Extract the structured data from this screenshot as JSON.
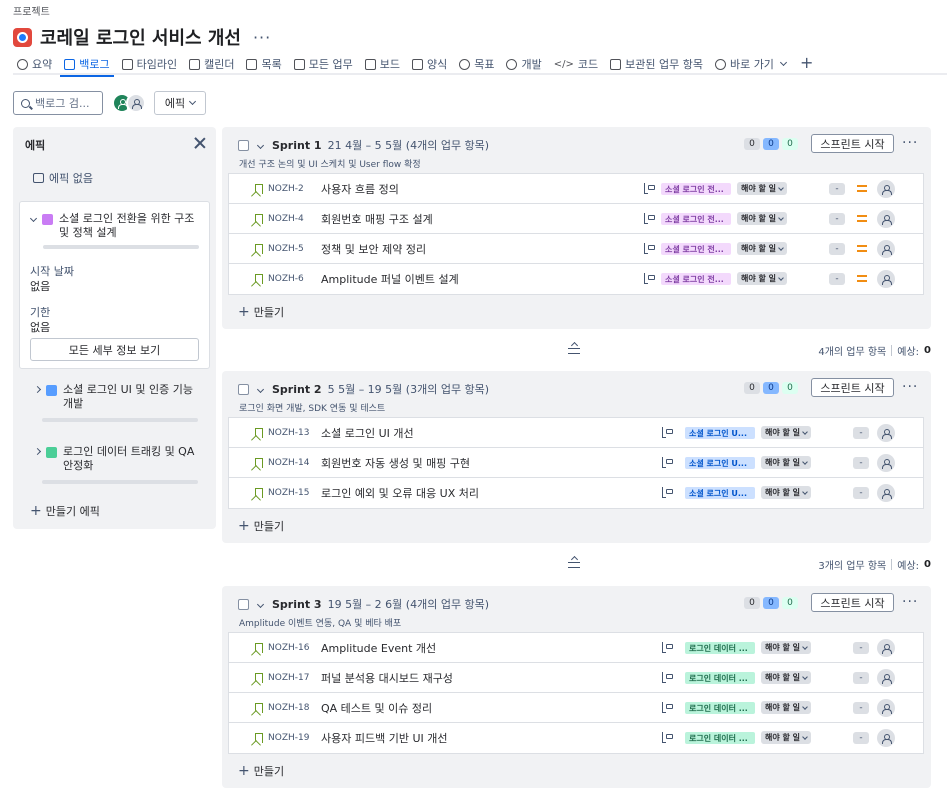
{
  "breadcrumb": "프로젝트",
  "page_title": "코레일 로그인 서비스 개선",
  "tabs": [
    {
      "label": "요약",
      "icon": "globe-icon",
      "active": false
    },
    {
      "label": "백로그",
      "icon": "backlog-icon",
      "active": true
    },
    {
      "label": "타임라인",
      "icon": "timeline-icon",
      "active": false
    },
    {
      "label": "캘린더",
      "icon": "calendar-icon",
      "active": false
    },
    {
      "label": "목록",
      "icon": "list-icon",
      "active": false
    },
    {
      "label": "모든 업무",
      "icon": "all-work-icon",
      "active": false
    },
    {
      "label": "보드",
      "icon": "board-icon",
      "active": false
    },
    {
      "label": "양식",
      "icon": "form-icon",
      "active": false
    },
    {
      "label": "목표",
      "icon": "goal-icon",
      "active": false
    },
    {
      "label": "개발",
      "icon": "lightbulb-icon",
      "active": false
    },
    {
      "label": "코드",
      "icon": "code-icon",
      "active": false
    },
    {
      "label": "보관된 업무 항목",
      "icon": "archive-icon",
      "active": false
    },
    {
      "label": "바로 가기",
      "icon": "link-icon",
      "active": false
    }
  ],
  "toolbar": {
    "search_placeholder": "백로그 검...",
    "epic_filter_label": "에픽"
  },
  "epic_panel": {
    "title": "에픽",
    "no_epic": "에픽 없음",
    "expanded_epic": {
      "title": "소셜 로그인 전환을 위한 구조 및 정책 설계",
      "color": "#c97cf4",
      "start_label": "시작 날짜",
      "start_value": "없음",
      "due_label": "기한",
      "due_value": "없음",
      "details_button": "모든 세부 정보 보기"
    },
    "collapsed_epics": [
      {
        "title": "소셜 로그인 UI 및 인증 기능 개발",
        "color": "#579dff"
      },
      {
        "title": "로그인 데이터 트래킹 및 QA 안정화",
        "color": "#4bce97"
      }
    ],
    "create_epic": "만들기 에픽"
  },
  "sprints": [
    {
      "name": "Sprint 1",
      "dates": "21 4월 – 5 5월 (4개의 업무 항목)",
      "goal": "개선 구조 논의 및 UI 스케치 및 User flow 확정",
      "counts": [
        "0",
        "0",
        "0"
      ],
      "start_button": "스프린트 시작",
      "create_label": "만들기",
      "issues": [
        {
          "key": "NOZH-2",
          "summary": "사용자 흐름 정의",
          "epic": "소셜 로그인 전...",
          "status": "해야 할 일",
          "estimate": "-"
        },
        {
          "key": "NOZH-4",
          "summary": "회원번호 매핑 구조 설계",
          "epic": "소셜 로그인 전...",
          "status": "해야 할 일",
          "estimate": "-"
        },
        {
          "key": "NOZH-5",
          "summary": "정책 및 보안 제약 정리",
          "epic": "소셜 로그인 전...",
          "status": "해야 할 일",
          "estimate": "-"
        },
        {
          "key": "NOZH-6",
          "summary": "Amplitude 퍼널 이벤트 설계",
          "epic": "소셜 로그인 전...",
          "status": "해야 할 일",
          "estimate": "-"
        }
      ]
    },
    {
      "name": "Sprint 2",
      "dates": "5 5월 – 19 5월 (3개의 업무 항목)",
      "goal": "로그인 화면 개발, SDK 연동 및 테스트",
      "counts": [
        "0",
        "0",
        "0"
      ],
      "start_button": "스프린트 시작",
      "create_label": "만들기",
      "issues": [
        {
          "key": "NOZH-13",
          "summary": "소셜 로그인 UI 개선",
          "epic": "소셜 로그인 U...",
          "status": "해야 할 일",
          "estimate": "-"
        },
        {
          "key": "NOZH-14",
          "summary": "회원번호 자동 생성 및 매핑 구현",
          "epic": "소셜 로그인 U...",
          "status": "해야 할 일",
          "estimate": "-"
        },
        {
          "key": "NOZH-15",
          "summary": "로그인 예외 및 오류 대응 UX 처리",
          "epic": "소셜 로그인 U...",
          "status": "해야 할 일",
          "estimate": "-"
        }
      ]
    },
    {
      "name": "Sprint 3",
      "dates": "19 5월 – 2 6월 (4개의 업무 항목)",
      "goal": "Amplitude 이벤트 연동, QA 및 베타 배포",
      "counts": [
        "0",
        "0",
        "0"
      ],
      "start_button": "스프린트 시작",
      "create_label": "만들기",
      "issues": [
        {
          "key": "NOZH-16",
          "summary": "Amplitude Event 개선",
          "epic": "로그인 데이터 ...",
          "status": "해야 할 일",
          "estimate": "-"
        },
        {
          "key": "NOZH-17",
          "summary": "퍼널 분석용 대시보드 재구성",
          "epic": "로그인 데이터 ...",
          "status": "해야 할 일",
          "estimate": "-"
        },
        {
          "key": "NOZH-18",
          "summary": "QA 테스트 및 이슈 정리",
          "epic": "로그인 데이터 ...",
          "status": "해야 할 일",
          "estimate": "-"
        },
        {
          "key": "NOZH-19",
          "summary": "사용자 피드백 기반 UI 개선",
          "epic": "로그인 데이터 ...",
          "status": "해야 할 일",
          "estimate": "-"
        }
      ]
    }
  ],
  "sprint_summaries": [
    {
      "items": "4개의 업무 항목",
      "estimate_label": "예상:",
      "estimate_value": "0"
    },
    {
      "items": "3개의 업무 항목",
      "estimate_label": "예상:",
      "estimate_value": "0"
    }
  ],
  "colors": {
    "accent": "#0c66e4",
    "epic_purple_bg": "#f3d9fc",
    "epic_purple_fg": "#803fa5",
    "epic_blue_bg": "#cce0ff",
    "epic_blue_fg": "#0055cc",
    "epic_green_bg": "#baf3db",
    "epic_green_fg": "#216e4e",
    "priority_medium": "#f18d13"
  }
}
